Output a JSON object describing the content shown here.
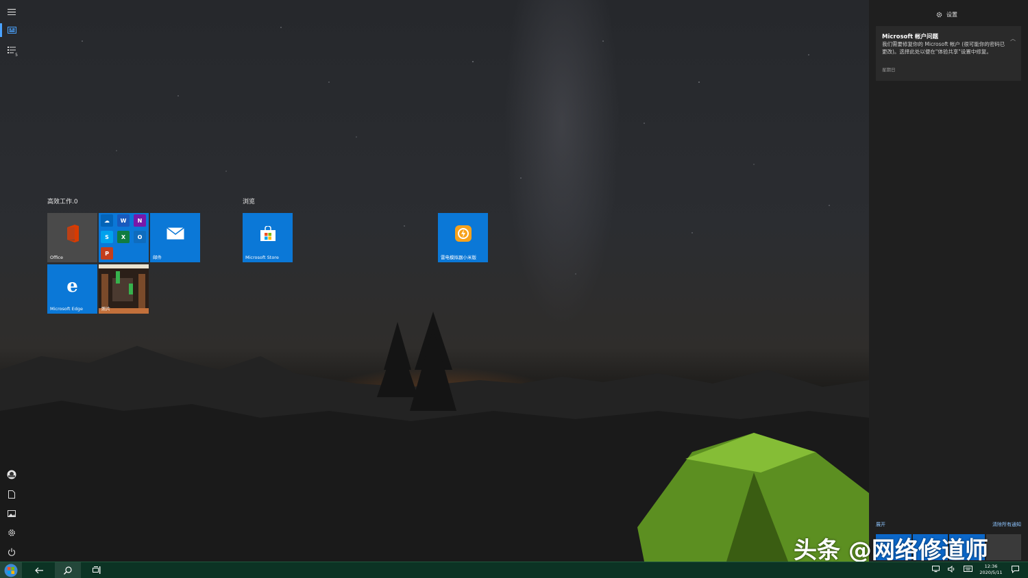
{
  "action_center": {
    "settings_label": "设置",
    "notification": {
      "title": "Microsoft 帐户问题",
      "body": "我们需要修复你的 Microsoft 帐户 (很可能你的密码已更改)。选择此处以便在\"体验共享\"设置中修复。",
      "time": "星期日"
    },
    "expand_label": "展开",
    "clear_label": "清除所有通知"
  },
  "left_rail": {
    "list_badge": "5"
  },
  "groups": [
    {
      "title": "高效工作.0",
      "tiles": [
        {
          "label": "Office",
          "icon": "office-icon"
        },
        {
          "label": "",
          "icon": "office-apps-folder-icon"
        },
        {
          "label": "邮件",
          "icon": "mail-icon"
        },
        {
          "label": "Microsoft Edge",
          "icon": "edge-icon"
        },
        {
          "label": "照片",
          "icon": "photos-icon"
        }
      ]
    },
    {
      "title": "浏览",
      "tiles": [
        {
          "label": "Microsoft Store",
          "icon": "store-icon"
        }
      ]
    },
    {
      "title": "",
      "tiles": [
        {
          "label": "雷电模拟器小米版",
          "icon": "ldplayer-icon"
        }
      ]
    }
  ],
  "taskbar": {
    "time": "12:36",
    "date": "2020/5/11"
  },
  "watermark": "头条 @网络修道师",
  "colors": {
    "tile_blue": "#0b78d7",
    "tile_gray": "#4a4a4a",
    "taskbar": "#0c3324",
    "action_center": "#1f1f1f",
    "link": "#8ec5ff"
  }
}
